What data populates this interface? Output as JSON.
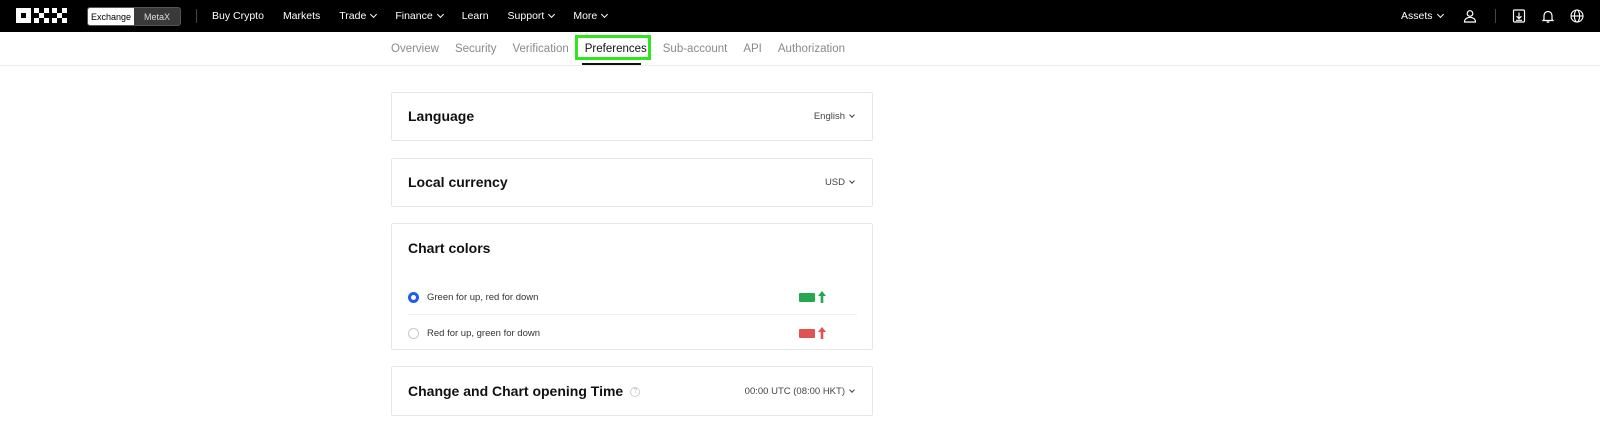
{
  "topnav": {
    "logo_text": "OKX",
    "toggle": {
      "exchange": "Exchange",
      "metax": "MetaX"
    },
    "links": [
      {
        "label": "Buy Crypto",
        "dropdown": false
      },
      {
        "label": "Markets",
        "dropdown": false
      },
      {
        "label": "Trade",
        "dropdown": true
      },
      {
        "label": "Finance",
        "dropdown": true
      },
      {
        "label": "Learn",
        "dropdown": false
      },
      {
        "label": "Support",
        "dropdown": true
      },
      {
        "label": "More",
        "dropdown": true
      }
    ],
    "assets_label": "Assets",
    "icons": [
      "user-icon",
      "download-icon",
      "bell-icon",
      "globe-icon"
    ]
  },
  "tabs": [
    {
      "label": "Overview"
    },
    {
      "label": "Security"
    },
    {
      "label": "Verification"
    },
    {
      "label": "Preferences",
      "active": true
    },
    {
      "label": "Sub-account"
    },
    {
      "label": "API"
    },
    {
      "label": "Authorization"
    }
  ],
  "language": {
    "title": "Language",
    "value": "English"
  },
  "currency": {
    "title": "Local currency",
    "value": "USD"
  },
  "chart_colors": {
    "title": "Chart colors",
    "options": [
      {
        "label": "Green for up, red for down",
        "selected": true,
        "color": "#25a750"
      },
      {
        "label": "Red for up, green for down",
        "selected": false,
        "color": "#e05353"
      }
    ]
  },
  "opening_time": {
    "title": "Change and Chart opening Time",
    "value": "00:00 UTC (08:00 HKT)"
  },
  "colors": {
    "accent_blue": "#1f5cf0",
    "highlight_green": "#2ee61c",
    "up_green": "#25a750",
    "up_red": "#e05353"
  }
}
